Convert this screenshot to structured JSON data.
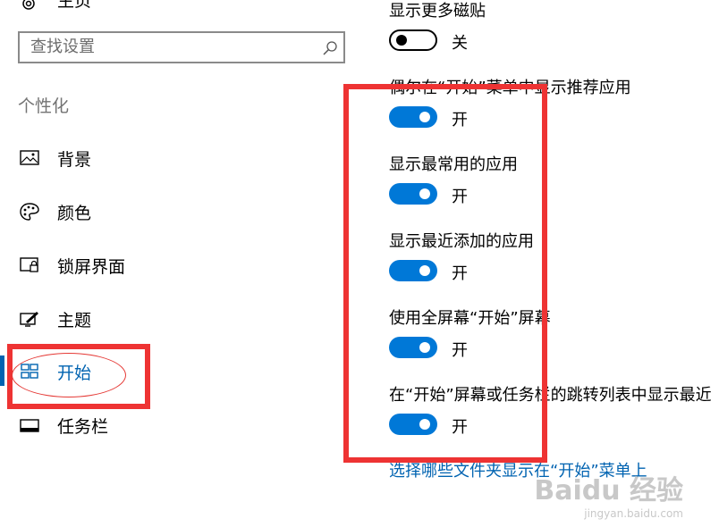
{
  "sidebar": {
    "home_label": "主页",
    "search": {
      "placeholder": "查找设置"
    },
    "section_label": "个性化",
    "items": [
      {
        "label": "背景",
        "icon": "picture-icon"
      },
      {
        "label": "颜色",
        "icon": "palette-icon"
      },
      {
        "label": "锁屏界面",
        "icon": "lock-screen-icon"
      },
      {
        "label": "主题",
        "icon": "theme-icon"
      },
      {
        "label": "开始",
        "icon": "start-tiles-icon",
        "selected": true
      },
      {
        "label": "任务栏",
        "icon": "taskbar-icon"
      }
    ]
  },
  "settings": [
    {
      "title": "显示更多磁贴",
      "state": "关",
      "on": false
    },
    {
      "title": "偶尔在“开始”菜单中显示推荐应用",
      "state": "开",
      "on": true
    },
    {
      "title": "显示最常用的应用",
      "state": "开",
      "on": true
    },
    {
      "title": "显示最近添加的应用",
      "state": "开",
      "on": true
    },
    {
      "title": "使用全屏幕“开始”屏幕",
      "state": "开",
      "on": true
    },
    {
      "title": "在“开始”屏幕或任务栏的跳转列表中显示最近",
      "state": "开",
      "on": true
    }
  ],
  "link": "选择哪些文件夹显示在“开始”菜单上",
  "colors": {
    "accent": "#0078d7",
    "selected_text": "#0063b1",
    "annotation": "#ee3333"
  },
  "watermark": {
    "logo": "Baidu 经验",
    "url": "jingyan.baidu.com"
  }
}
